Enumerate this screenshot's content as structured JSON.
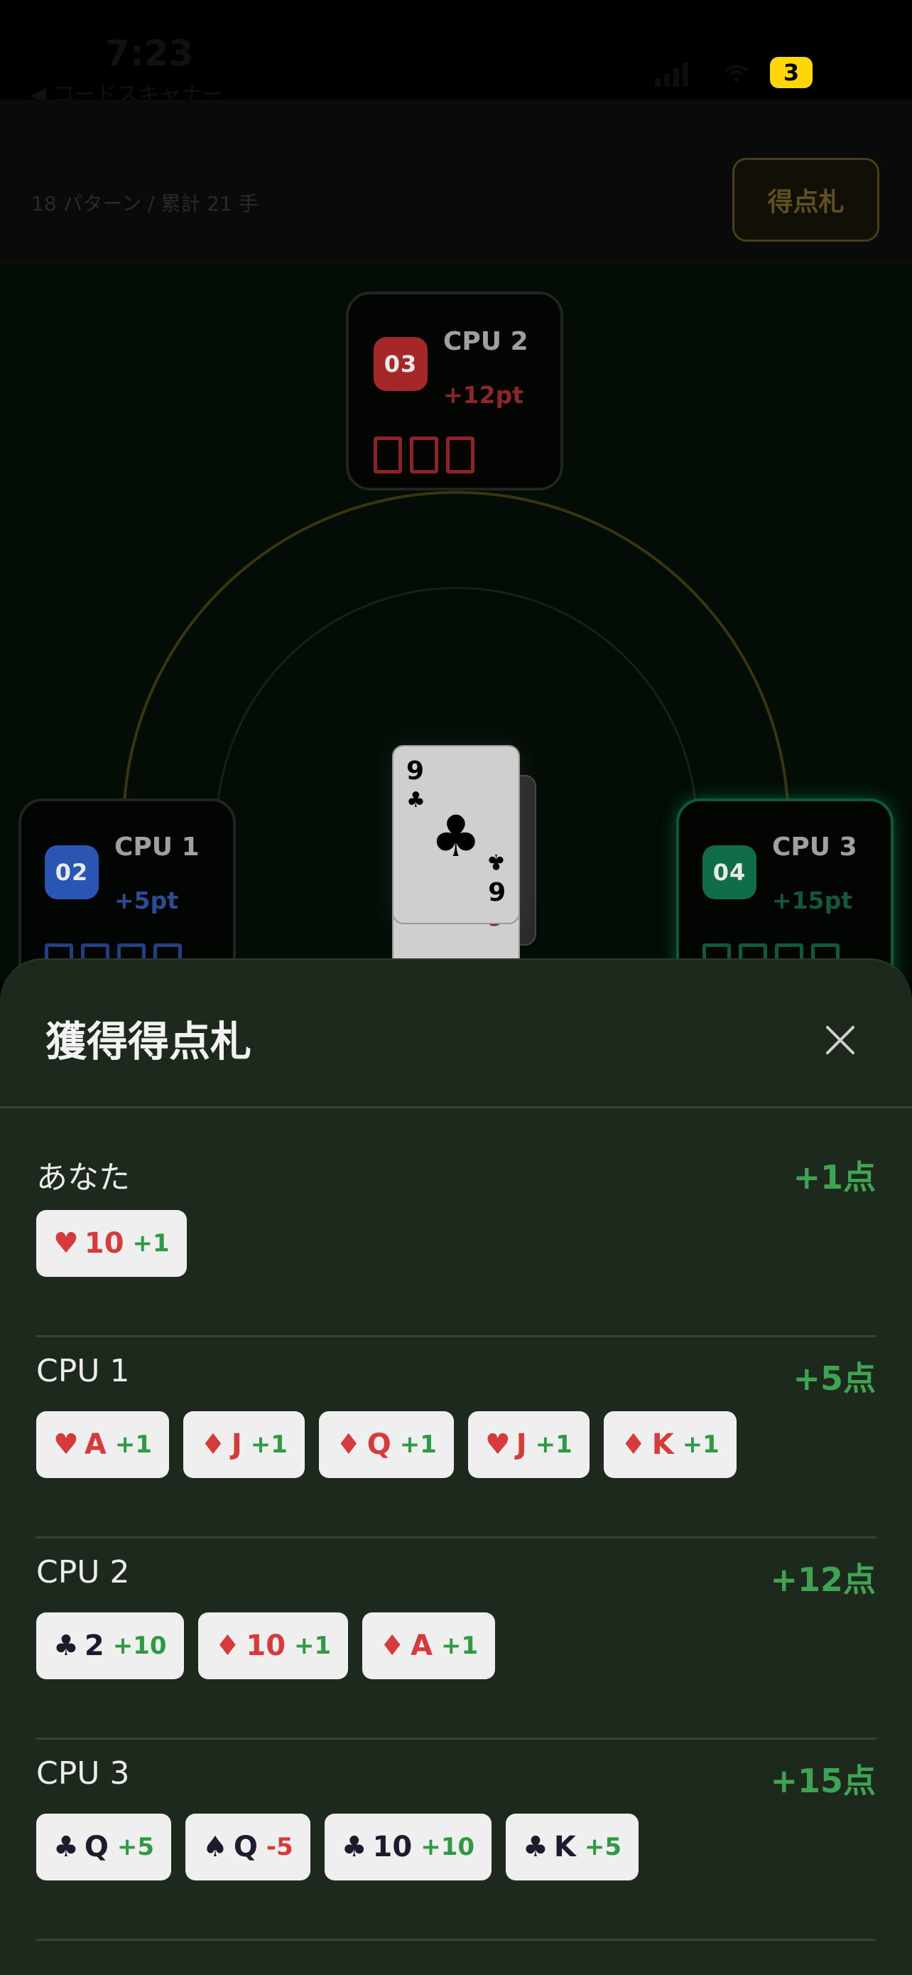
{
  "status_bar": {
    "time": "7:23",
    "back_label": "◀ コードスキャナー",
    "battery": "3"
  },
  "header": {
    "pattern_count": "18 パターン / 累計 21 手",
    "score_cards_button": "得点札"
  },
  "table": {
    "players": [
      {
        "id": "cpu2",
        "badge": "03",
        "name": "CPU 2",
        "points": "+12pt",
        "slots": 3,
        "color": "#a52727"
      },
      {
        "id": "cpu1",
        "badge": "02",
        "name": "CPU 1",
        "points": "+5pt",
        "slots": 4,
        "color": "#2a56b3"
      },
      {
        "id": "cpu3",
        "badge": "04",
        "name": "CPU 3",
        "points": "+15pt",
        "slots": 4,
        "color": "#0f6e48"
      }
    ],
    "center_card": {
      "rank": "9",
      "suit": "♣",
      "rank_bottom": "6",
      "under_rank": "9"
    }
  },
  "sheet": {
    "title": "獲得得点札",
    "close_icon": "close-icon",
    "sections": [
      {
        "id": "you",
        "name": "あなた",
        "total": "+1点",
        "cards": [
          {
            "suit": "♥",
            "rank": "10",
            "pt": "+1",
            "red": true
          }
        ]
      },
      {
        "id": "cpu1",
        "name": "CPU 1",
        "total": "+5点",
        "cards": [
          {
            "suit": "♥",
            "rank": "A",
            "pt": "+1",
            "red": true
          },
          {
            "suit": "♦",
            "rank": "J",
            "pt": "+1",
            "red": true
          },
          {
            "suit": "♦",
            "rank": "Q",
            "pt": "+1",
            "red": true
          },
          {
            "suit": "♥",
            "rank": "J",
            "pt": "+1",
            "red": true
          },
          {
            "suit": "♦",
            "rank": "K",
            "pt": "+1",
            "red": true
          }
        ]
      },
      {
        "id": "cpu2",
        "name": "CPU 2",
        "total": "+12点",
        "cards": [
          {
            "suit": "♣",
            "rank": "2",
            "pt": "+10",
            "red": false
          },
          {
            "suit": "♦",
            "rank": "10",
            "pt": "+1",
            "red": true
          },
          {
            "suit": "♦",
            "rank": "A",
            "pt": "+1",
            "red": true
          }
        ]
      },
      {
        "id": "cpu3",
        "name": "CPU 3",
        "total": "+15点",
        "cards": [
          {
            "suit": "♣",
            "rank": "Q",
            "pt": "+5",
            "red": false
          },
          {
            "suit": "♠",
            "rank": "Q",
            "pt": "-5",
            "red": false,
            "negative": true
          },
          {
            "suit": "♣",
            "rank": "10",
            "pt": "+10",
            "red": false
          },
          {
            "suit": "♣",
            "rank": "K",
            "pt": "+5",
            "red": false
          }
        ]
      }
    ]
  },
  "colors": {
    "accent_green": "#3fa452",
    "sheet_bg": "#1e291d",
    "card_red": "#d63a3a"
  }
}
